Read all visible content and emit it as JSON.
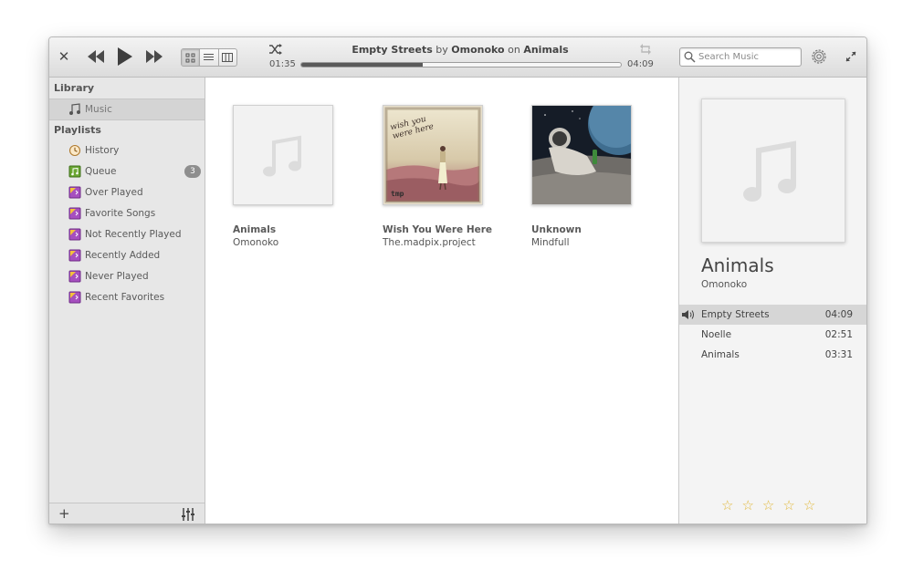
{
  "header": {
    "now_playing": {
      "track": "Empty Streets",
      "by": "by",
      "artist": "Omonoko",
      "on": "on",
      "album": "Animals"
    },
    "elapsed": "01:35",
    "total": "04:09",
    "progress_fraction": 0.38,
    "search_placeholder": "Search Music",
    "icons": [
      "close-icon",
      "previous-icon",
      "play-icon",
      "next-icon",
      "grid-view-icon",
      "list-view-icon",
      "column-view-icon",
      "shuffle-icon",
      "repeat-icon",
      "search-icon",
      "gear-icon",
      "fullscreen-icon"
    ]
  },
  "sidebar": {
    "library_heading": "Library",
    "library_items": [
      {
        "label": "Music",
        "icon": "music-note-icon"
      }
    ],
    "playlists_heading": "Playlists",
    "playlists": [
      {
        "label": "History",
        "icon": "history-icon"
      },
      {
        "label": "Queue",
        "icon": "queue-icon",
        "badge": "3"
      },
      {
        "label": "Over Played",
        "icon": "smart-playlist-icon"
      },
      {
        "label": "Favorite Songs",
        "icon": "smart-playlist-icon"
      },
      {
        "label": "Not Recently Played",
        "icon": "smart-playlist-icon"
      },
      {
        "label": "Recently Added",
        "icon": "smart-playlist-icon"
      },
      {
        "label": "Never Played",
        "icon": "smart-playlist-icon"
      },
      {
        "label": "Recent Favorites",
        "icon": "smart-playlist-icon"
      }
    ],
    "footer": {
      "add_label": "+",
      "icons": [
        "add-icon",
        "equalizer-icon"
      ]
    }
  },
  "albums": [
    {
      "title": "Animals",
      "artist": "Omonoko"
    },
    {
      "title": "Wish You Were Here",
      "artist": "The.madpix.project",
      "cover_text": "wish you were here",
      "cover_logo": "tmp"
    },
    {
      "title": "Unknown",
      "artist": "Mindfull"
    }
  ],
  "info_panel": {
    "album": "Animals",
    "artist": "Omonoko",
    "tracks": [
      {
        "name": "Empty Streets",
        "duration": "04:09",
        "playing": true
      },
      {
        "name": "Noelle",
        "duration": "02:51"
      },
      {
        "name": "Animals",
        "duration": "03:31"
      }
    ],
    "rating": {
      "value": 0,
      "max": 5
    },
    "colors": {
      "star": "#e2b83a",
      "selected_row": "#d6d6d6"
    }
  }
}
